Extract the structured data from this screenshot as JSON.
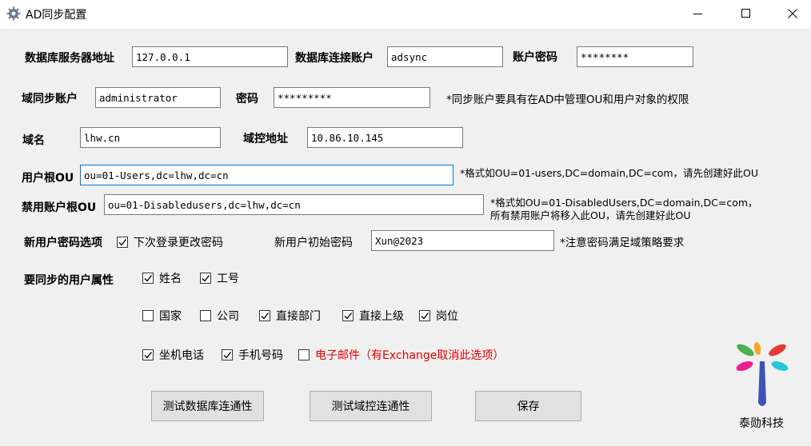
{
  "window": {
    "title": "AD同步配置"
  },
  "db": {
    "server_label": "数据库服务器地址",
    "server_value": "127.0.0.1",
    "account_label": "数据库连接账户",
    "account_value": "adsync",
    "password_label": "账户密码",
    "password_value": "********"
  },
  "domain_sync": {
    "account_label": "域同步账户",
    "account_value": "administrator",
    "password_label": "密码",
    "password_value": "*********",
    "note": "*同步账户要具有在AD中管理OU和用户对象的权限"
  },
  "domain": {
    "name_label": "域名",
    "name_value": "lhw.cn",
    "dc_label": "域控地址",
    "dc_value": "10.86.10.145"
  },
  "user_ou": {
    "label": "用户根OU",
    "value": "ou=01-Users,dc=lhw,dc=cn",
    "note": "*格式如OU=01-users,DC=domain,DC=com，请先创建好此OU"
  },
  "disabled_ou": {
    "label": "禁用账户根OU",
    "value": "ou=01-Disabledusers,dc=lhw,dc=cn",
    "note_line1": "*格式如OU=01-DisabledUsers,DC=domain,DC=com，",
    "note_line2": "所有禁用账户将移入此OU，请先创建好此OU"
  },
  "new_user": {
    "options_label": "新用户密码选项",
    "change_pwd_label": "下次登录更改密码",
    "change_pwd_checked": true,
    "init_pwd_label": "新用户初始密码",
    "init_pwd_value": "Xun@2023",
    "init_pwd_note": "*注意密码满足域策略要求"
  },
  "attributes": {
    "label": "要同步的用户属性",
    "items": [
      {
        "label": "姓名",
        "checked": true
      },
      {
        "label": "工号",
        "checked": true
      },
      {
        "label": "国家",
        "checked": false
      },
      {
        "label": "公司",
        "checked": false
      },
      {
        "label": "直接部门",
        "checked": true
      },
      {
        "label": "直接上级",
        "checked": true
      },
      {
        "label": "岗位",
        "checked": true
      },
      {
        "label": "坐机电话",
        "checked": true
      },
      {
        "label": "手机号码",
        "checked": true
      },
      {
        "label": "电子邮件（有Exchange取消此选项）",
        "checked": false
      }
    ]
  },
  "buttons": {
    "test_db": "测试数据库连通性",
    "test_dc": "测试域控连通性",
    "save": "保存"
  },
  "brand": {
    "name": "泰勋科技"
  },
  "colors": {
    "accent": "#0078d7",
    "warning_text": "#e00000"
  }
}
